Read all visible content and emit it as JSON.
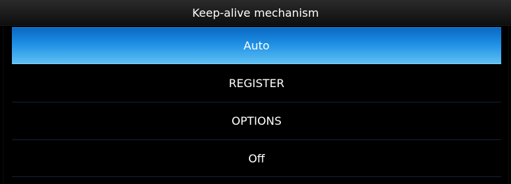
{
  "dialog": {
    "title": "Keep-alive mechanism",
    "options": [
      {
        "label": "Auto",
        "selected": true
      },
      {
        "label": "REGISTER",
        "selected": false
      },
      {
        "label": "OPTIONS",
        "selected": false
      },
      {
        "label": "Off",
        "selected": false
      }
    ],
    "selection_color": "#1e8fe5"
  }
}
